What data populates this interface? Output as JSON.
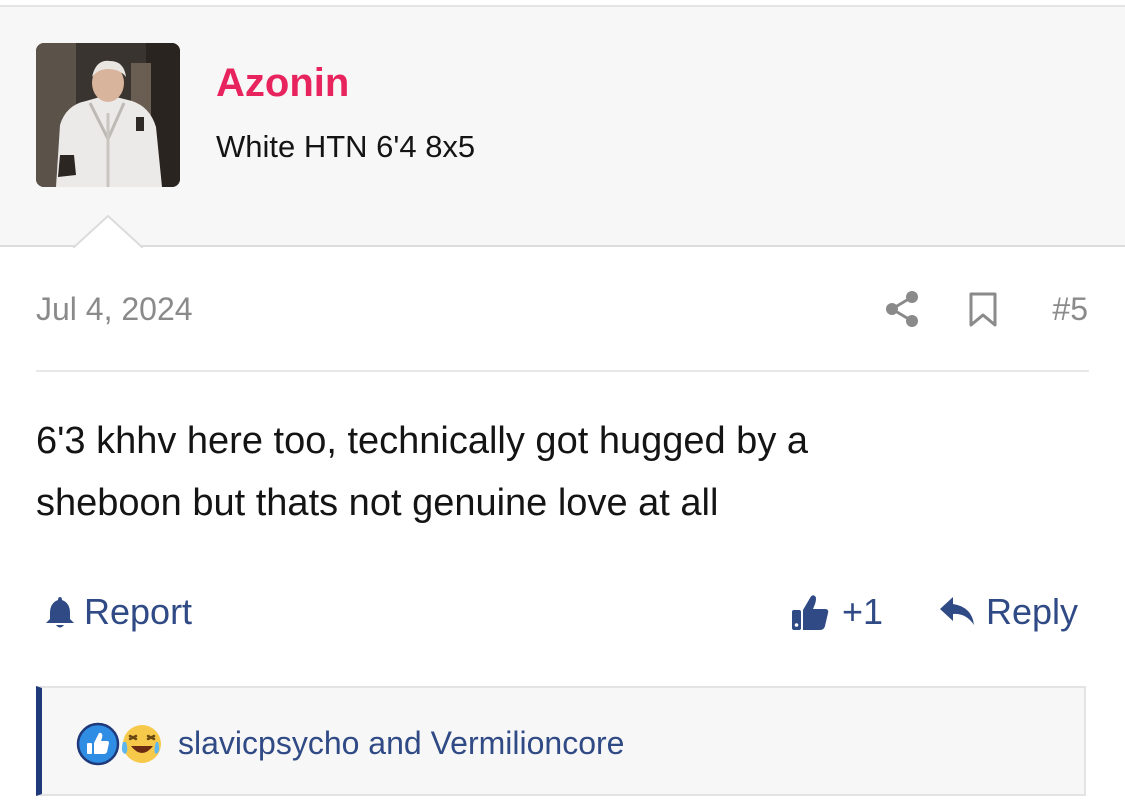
{
  "post": {
    "author": "Azonin",
    "user_title": "White HTN 6'4 8x5",
    "date": "Jul 4, 2024",
    "number": "#5",
    "body_line1": "6'3 khhv here too, technically got hugged by a",
    "body_line2": "sheboon but thats not genuine love at all"
  },
  "actions": {
    "report_label": "Report",
    "like_label": "+1",
    "reply_label": "Reply"
  },
  "reactions": {
    "names": "slavicpsycho and Vermilioncore",
    "icons": [
      "like-reaction-icon",
      "laugh-cry-reaction-icon"
    ]
  },
  "colors": {
    "username": "#e8245f",
    "action_blue": "#2f4a85",
    "reaction_border": "#1f3a7a"
  }
}
